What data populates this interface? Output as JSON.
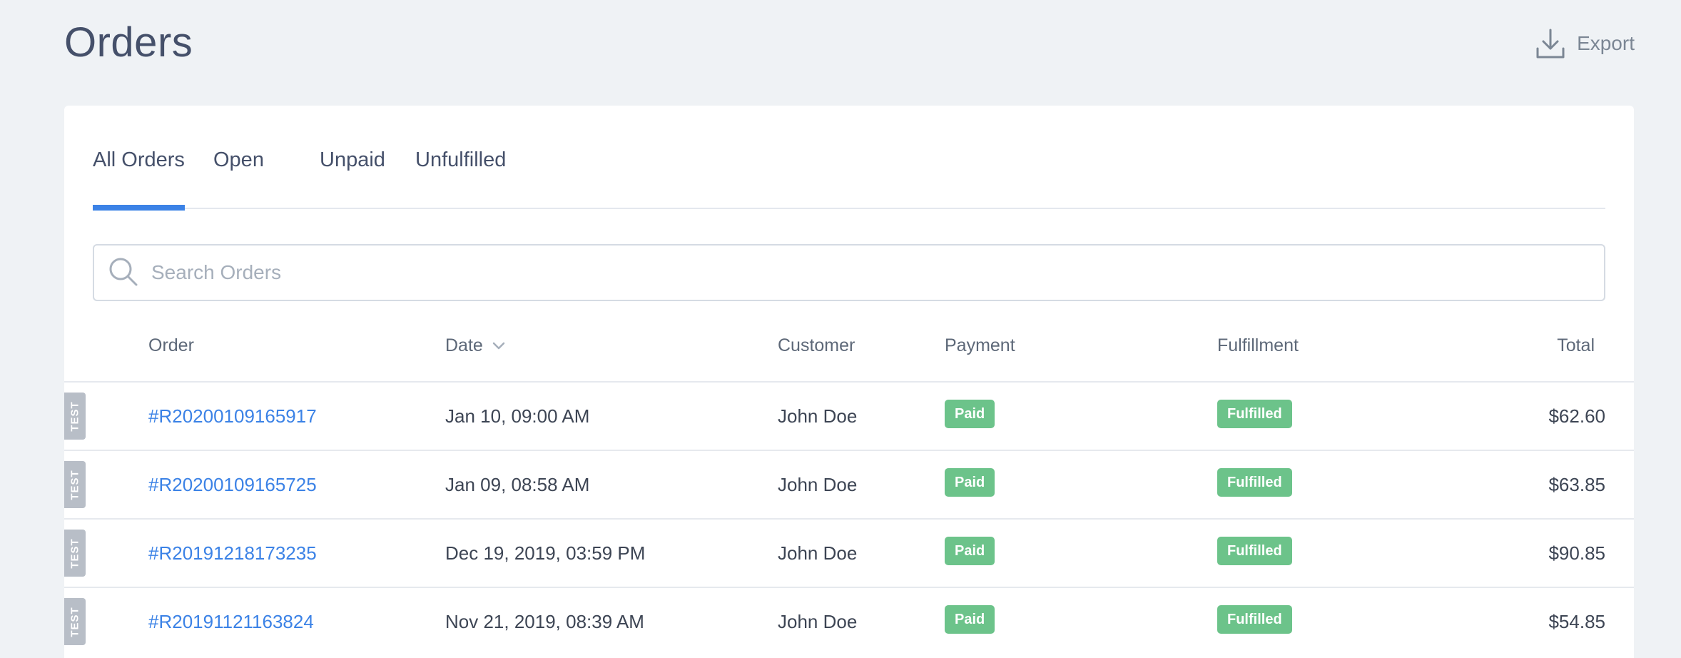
{
  "header": {
    "title": "Orders",
    "export_label": "Export",
    "export_icon": "download-icon"
  },
  "tabs": [
    {
      "label": "All Orders",
      "active": true
    },
    {
      "label": "Open",
      "active": false
    },
    {
      "label": "Unpaid",
      "active": false
    },
    {
      "label": "Unfulfilled",
      "active": false
    }
  ],
  "search": {
    "placeholder": "Search Orders",
    "value": "",
    "icon": "search-icon"
  },
  "table": {
    "columns": {
      "order": "Order",
      "date": "Date",
      "customer": "Customer",
      "payment": "Payment",
      "fulfillment": "Fulfillment",
      "total": "Total"
    },
    "sort_icon": "chevron-down-icon",
    "rows": [
      {
        "tag": "TEST",
        "order": "#R20200109165917",
        "date": "Jan 10, 09:00 AM",
        "customer": "John Doe",
        "payment": "Paid",
        "fulfillment": "Fulfilled",
        "total": "$62.60"
      },
      {
        "tag": "TEST",
        "order": "#R20200109165725",
        "date": "Jan 09, 08:58 AM",
        "customer": "John Doe",
        "payment": "Paid",
        "fulfillment": "Fulfilled",
        "total": "$63.85"
      },
      {
        "tag": "TEST",
        "order": "#R20191218173235",
        "date": "Dec 19, 2019, 03:59 PM",
        "customer": "John Doe",
        "payment": "Paid",
        "fulfillment": "Fulfilled",
        "total": "$90.85"
      },
      {
        "tag": "TEST",
        "order": "#R20191121163824",
        "date": "Nov 21, 2019, 08:39 AM",
        "customer": "John Doe",
        "payment": "Paid",
        "fulfillment": "Fulfilled",
        "total": "$54.85"
      }
    ]
  },
  "colors": {
    "accent": "#3b82e6",
    "badge_green": "#6cc38a",
    "test_tag": "#b8bec7",
    "background": "#eff2f5"
  }
}
